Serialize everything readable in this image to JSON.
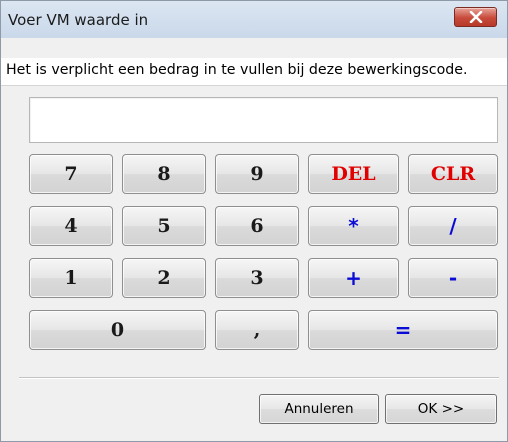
{
  "window": {
    "title": "Voer VM waarde in",
    "close_icon": "close-icon"
  },
  "message": "Het is verplicht een bedrag in te vullen bij deze bewerkingscode.",
  "display": {
    "value": ""
  },
  "keypad": {
    "rows": [
      [
        "7",
        "8",
        "9",
        "DEL",
        "CLR"
      ],
      [
        "4",
        "5",
        "6",
        "*",
        "/"
      ],
      [
        "1",
        "2",
        "3",
        "+",
        "-"
      ],
      [
        "0",
        ",",
        "="
      ]
    ]
  },
  "buttons": {
    "cancel_label": "Annuleren",
    "ok_label": "OK >>"
  },
  "colors": {
    "red_keys": "#e00000",
    "blue_keys": "#0b0bd6"
  }
}
